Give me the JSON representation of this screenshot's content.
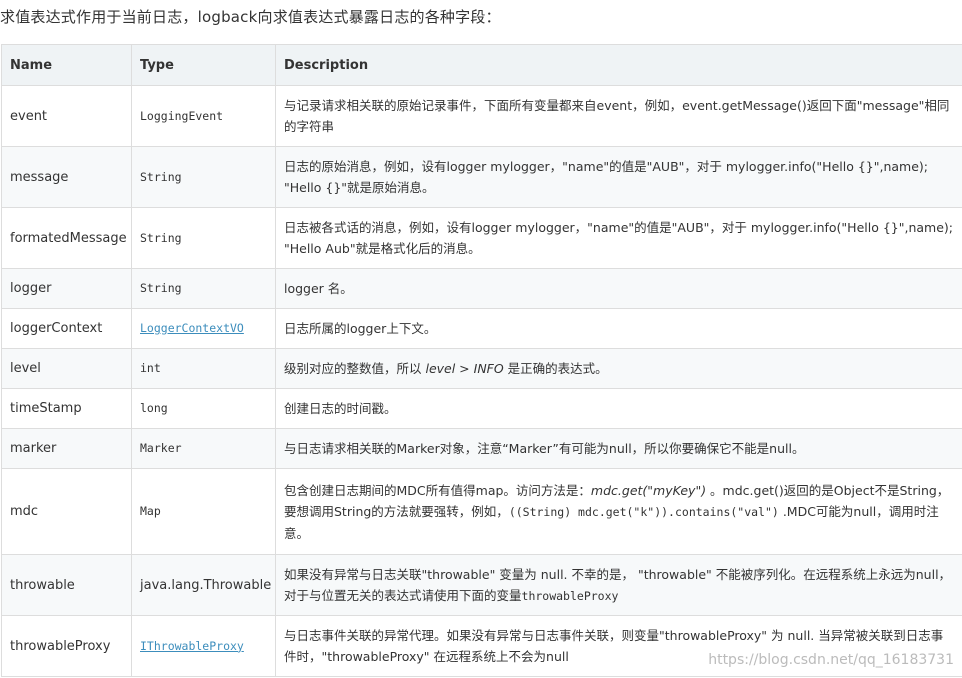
{
  "intro": "求值表达式作用于当前日志，logback向求值表达式暴露日志的各种字段：",
  "headers": {
    "name": "Name",
    "type": "Type",
    "description": "Description"
  },
  "rows": [
    {
      "name": "event",
      "type": "LoggingEvent",
      "desc": "与记录请求相关联的原始记录事件，下面所有变量都来自event，例如，event.getMessage()返回下面\"message\"相同的字符串"
    },
    {
      "name": "message",
      "type": "String",
      "desc": "日志的原始消息，例如，设有logger mylogger，\"name\"的值是\"AUB\"，对于 mylogger.info(\"Hello {}\",name); \"Hello {}\"就是原始消息。"
    },
    {
      "name": "formatedMessage",
      "type": "String",
      "desc": "日志被各式话的消息，例如，设有logger mylogger，\"name\"的值是\"AUB\"，对于 mylogger.info(\"Hello {}\",name); \"Hello Aub\"就是格式化后的消息。"
    },
    {
      "name": "logger",
      "type": "String",
      "desc": "logger 名。"
    },
    {
      "name": "loggerContext",
      "type": "LoggerContextVO",
      "desc": "日志所属的logger上下文。"
    },
    {
      "name": "level",
      "type": "int",
      "desc_pre": "级别对应的整数值，所以 ",
      "desc_em": "level > INFO",
      "desc_post": " 是正确的表达式。"
    },
    {
      "name": "timeStamp",
      "type": "long",
      "desc": "创建日志的时间戳。"
    },
    {
      "name": "marker",
      "type": "Marker",
      "desc": "与日志请求相关联的Marker对象，注意“Marker”有可能为null，所以你要确保它不能是null。"
    },
    {
      "name": "mdc",
      "type": "Map",
      "desc_1": "包含创建日志期间的MDC所有值得map。访问方法是：",
      "desc_em": "mdc.get(\"myKey\")",
      "desc_2": " 。mdc.get()返回的是Object不是String，要想调用String的方法就要强转，例如，",
      "desc_code": "((String) mdc.get(\"k\")).contains(\"val\")",
      "desc_3": " .MDC可能为null，调用时注意。"
    },
    {
      "name": "throwable",
      "type": "java.lang.Throwable",
      "desc_1": "如果没有异常与日志关联\"throwable\" 变量为 null. 不幸的是， \"throwable\" 不能被序列化。在远程系统上永远为null，对于与位置无关的表达式请使用下面的变量",
      "desc_code": "throwableProxy"
    },
    {
      "name": "throwableProxy",
      "type": "IThrowableProxy",
      "desc": "与日志事件关联的异常代理。如果没有异常与日志事件关联，则变量\"throwableProxy\" 为 null. 当异常被关联到日志事件时，\"throwableProxy\" 在远程系统上不会为null"
    }
  ],
  "watermark": "https://blog.csdn.net/qq_16183731"
}
